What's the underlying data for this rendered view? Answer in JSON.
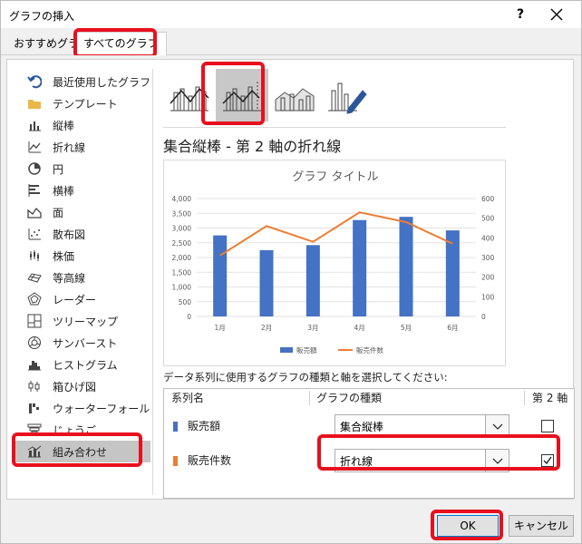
{
  "window": {
    "title": "グラフの挿入",
    "help": "?",
    "close": "✕"
  },
  "tabs": [
    {
      "label": "おすすめグラフ"
    },
    {
      "label": "すべてのグラフ"
    }
  ],
  "sidebar": {
    "items": [
      {
        "label": "最近使用したグラフ",
        "icon": "undo-icon"
      },
      {
        "label": "テンプレート",
        "icon": "folder-icon"
      },
      {
        "label": "縦棒",
        "icon": "column-chart-icon"
      },
      {
        "label": "折れ線",
        "icon": "line-chart-icon"
      },
      {
        "label": "円",
        "icon": "pie-chart-icon"
      },
      {
        "label": "横棒",
        "icon": "bar-chart-icon"
      },
      {
        "label": "面",
        "icon": "area-chart-icon"
      },
      {
        "label": "散布図",
        "icon": "scatter-chart-icon"
      },
      {
        "label": "株価",
        "icon": "stock-chart-icon"
      },
      {
        "label": "等高線",
        "icon": "surface-chart-icon"
      },
      {
        "label": "レーダー",
        "icon": "radar-chart-icon"
      },
      {
        "label": "ツリーマップ",
        "icon": "treemap-chart-icon"
      },
      {
        "label": "サンバースト",
        "icon": "sunburst-chart-icon"
      },
      {
        "label": "ヒストグラム",
        "icon": "histogram-chart-icon"
      },
      {
        "label": "箱ひげ図",
        "icon": "box-whisker-chart-icon"
      },
      {
        "label": "ウォーターフォール",
        "icon": "waterfall-chart-icon"
      },
      {
        "label": "じょうご",
        "icon": "funnel-chart-icon"
      },
      {
        "label": "組み合わせ",
        "icon": "combo-chart-icon"
      }
    ]
  },
  "combo_types": [
    {
      "icon": "clustered-column-line-icon"
    },
    {
      "icon": "clustered-column-line-secondary-axis-icon"
    },
    {
      "icon": "stacked-area-clustered-column-icon"
    },
    {
      "icon": "custom-combination-icon"
    }
  ],
  "subtitle": "集合縦棒 - 第 2 軸の折れ線",
  "colors": {
    "bar": "#4472c4",
    "line": "#ed7d31",
    "highlight": "#e8101e",
    "selected_bg": "#c5c5c5"
  },
  "chart_data": {
    "type": "bar",
    "title": "グラフ タイトル",
    "categories": [
      "1月",
      "2月",
      "3月",
      "4月",
      "5月",
      "6月"
    ],
    "series": [
      {
        "name": "販売額",
        "type": "bar",
        "axis": "primary",
        "values": [
          2750,
          2250,
          2420,
          3270,
          3380,
          2920
        ]
      },
      {
        "name": "販売件数",
        "type": "line",
        "axis": "secondary",
        "values": [
          310,
          460,
          380,
          530,
          480,
          370
        ]
      }
    ],
    "primary_axis": {
      "ylim": [
        0,
        4000
      ],
      "ticks": [
        "0",
        "500",
        "1,000",
        "1,500",
        "2,000",
        "2,500",
        "3,000",
        "3,500",
        "4,000"
      ]
    },
    "secondary_axis": {
      "ylim": [
        0,
        600
      ],
      "ticks": [
        "0",
        "100",
        "200",
        "300",
        "400",
        "500",
        "600"
      ]
    },
    "grid": true,
    "legend": "bottom"
  },
  "instruction": "データ系列に使用するグラフの種類と軸を選択してください:",
  "table": {
    "headers": [
      "系列名",
      "グラフの種類",
      "第 2 軸"
    ],
    "rows": [
      {
        "name": "販売額",
        "chart_type": "集合縦棒",
        "secondary": false,
        "color": "#4472c4"
      },
      {
        "name": "販売件数",
        "chart_type": "折れ線",
        "secondary": true,
        "color": "#ed7d31"
      }
    ]
  },
  "footer": {
    "ok": "OK",
    "cancel": "キャンセル"
  }
}
